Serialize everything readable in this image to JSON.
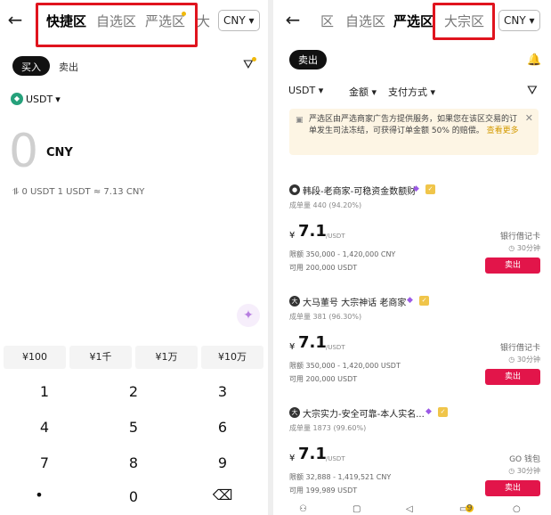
{
  "left": {
    "back_icon": "←",
    "tabs": [
      "快捷区",
      "自选区",
      "严选区",
      "大"
    ],
    "currency": "CNY ▾",
    "side_buy": "买入",
    "side_sell": "卖出",
    "filter_icon": "⛛",
    "coin": "USDT",
    "coin_caret": "▾",
    "amount": "0",
    "amount_currency": "CNY",
    "rate_text": "⥮ 0 USDT   1 USDT ≈ 7.13 CNY",
    "sparkle_icon": "✦",
    "quick_amounts": [
      "¥100",
      "¥1千",
      "¥1万",
      "¥10万"
    ],
    "keys": [
      "1",
      "2",
      "3",
      "4",
      "5",
      "6",
      "7",
      "8",
      "9",
      "•",
      "0",
      "⌫"
    ]
  },
  "right": {
    "back_icon": "←",
    "tabs": [
      "区",
      "自选区",
      "严选区",
      "大宗区"
    ],
    "currency": "CNY ▾",
    "side_sell": "卖出",
    "bell_icon": "🔔",
    "filters": [
      "USDT ▾",
      "金额 ▾",
      "支付方式 ▾"
    ],
    "filter_icon": "⛛",
    "notice": {
      "icon": "▣",
      "text": "严选区由严选商家广告方提供服务，如果您在该区交易的订单发生司法冻结，可获得订单金额 50% 的赔偿。",
      "more": "查看更多",
      "close": "✕"
    },
    "merchants": [
      {
        "avatar": "●",
        "name": "韩段-老商家-可稳资金数额财",
        "stats": "成单量 440 (94.20%)",
        "currency_symbol": "¥",
        "price": "7.1",
        "unit": "/USDT",
        "limit": "限额  350,000 - 1,420,000 CNY",
        "available": "可用  200,000 USDT",
        "payment": "银行借记卡",
        "time": "◷ 30分钟",
        "action": "卖出"
      },
      {
        "avatar": "大",
        "name": "大马董号 大宗神话 老商家",
        "stats": "成单量 381 (96.30%)",
        "currency_symbol": "¥",
        "price": "7.1",
        "unit": "/USDT",
        "limit": "限额  350,000 - 1,420,000 USDT",
        "available": "可用  200,000 USDT",
        "payment": "银行借记卡",
        "time": "◷ 30分钟",
        "action": "卖出"
      },
      {
        "avatar": "大",
        "name": "大宗实力-安全可靠-本人实名...",
        "stats": "成单量 1873 (99.60%)",
        "currency_symbol": "¥",
        "price": "7.1",
        "unit": "/USDT",
        "limit": "限额  32,888 - 1,419,521 CNY",
        "available": "可用  199,989 USDT",
        "payment": "GO 钱包",
        "time": "◷ 30分钟",
        "action": "卖出"
      }
    ],
    "nav_badge": "9"
  }
}
